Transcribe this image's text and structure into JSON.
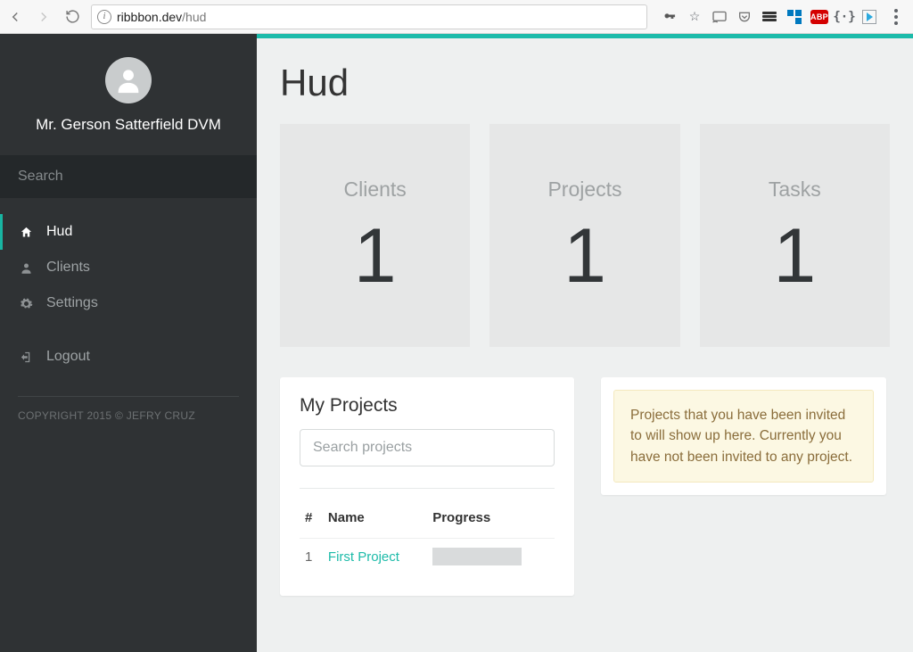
{
  "browser": {
    "url_domain": "ribbbon.dev",
    "url_path": "/hud"
  },
  "sidebar": {
    "user_name": "Mr. Gerson Satterfield DVM",
    "search_placeholder": "Search",
    "items": [
      {
        "label": "Hud",
        "icon": "home-icon",
        "active": true
      },
      {
        "label": "Clients",
        "icon": "user-icon",
        "active": false
      },
      {
        "label": "Settings",
        "icon": "gear-icon",
        "active": false
      }
    ],
    "logout_label": "Logout",
    "copyright": "COPYRIGHT 2015 © JEFRY CRUZ"
  },
  "page_title": "Hud",
  "stats": {
    "clients": {
      "label": "Clients",
      "value": "1"
    },
    "projects": {
      "label": "Projects",
      "value": "1"
    },
    "tasks": {
      "label": "Tasks",
      "value": "1"
    }
  },
  "my_projects": {
    "title": "My Projects",
    "search_placeholder": "Search projects",
    "columns": {
      "index": "#",
      "name": "Name",
      "progress": "Progress"
    },
    "rows": [
      {
        "index": "1",
        "name": "First Project",
        "progress_pct": 0
      }
    ]
  },
  "invites": {
    "message": "Projects that you have been invited to will show up here. Currently you have not been invited to any project."
  }
}
